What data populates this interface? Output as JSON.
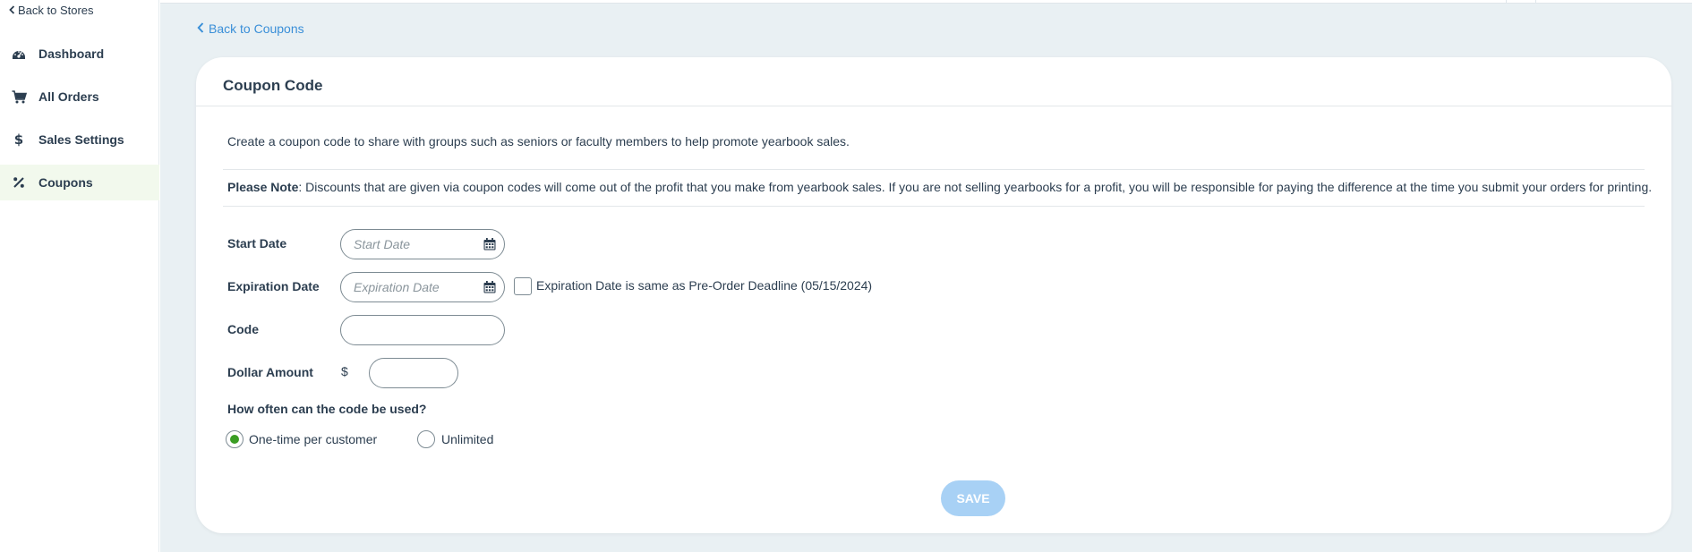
{
  "sidebar": {
    "back_label": "Back to Stores",
    "items": [
      {
        "label": "Dashboard",
        "icon": "dashboard-icon"
      },
      {
        "label": "All Orders",
        "icon": "cart-icon"
      },
      {
        "label": "Sales Settings",
        "icon": "dollar-icon"
      },
      {
        "label": "Coupons",
        "icon": "percent-icon",
        "active": true
      }
    ]
  },
  "main": {
    "back_label": "Back to Coupons",
    "card": {
      "title": "Coupon Code",
      "intro": "Create a coupon code to share with groups such as seniors or faculty members to help promote yearbook sales.",
      "note_label": "Please Note",
      "note_text": ": Discounts that are given via coupon codes will come out of the profit that you make from yearbook sales. If you are not selling yearbooks for a profit, you will be responsible for paying the difference at the time you submit your orders for printing.",
      "start_date": {
        "label": "Start Date",
        "placeholder": "Start Date",
        "value": ""
      },
      "expiration_date": {
        "label": "Expiration Date",
        "placeholder": "Expiration Date",
        "value": "",
        "same_as_deadline_label": "Expiration Date is same as Pre-Order Deadline (05/15/2024)",
        "same_as_deadline_checked": false
      },
      "code": {
        "label": "Code",
        "value": ""
      },
      "dollar_amount": {
        "label": "Dollar Amount",
        "currency": "$",
        "value": ""
      },
      "usage": {
        "question": "How often can the code be used?",
        "options": [
          {
            "label": "One-time per customer",
            "selected": true
          },
          {
            "label": "Unlimited",
            "selected": false
          }
        ]
      },
      "save_label": "SAVE"
    }
  },
  "colors": {
    "accent_link": "#3a8fd8",
    "radio_selected": "#3a9d23",
    "save_disabled": "#a8d1f5",
    "active_nav_bg": "#f2f9ed",
    "page_bg": "#e9f0f3"
  }
}
